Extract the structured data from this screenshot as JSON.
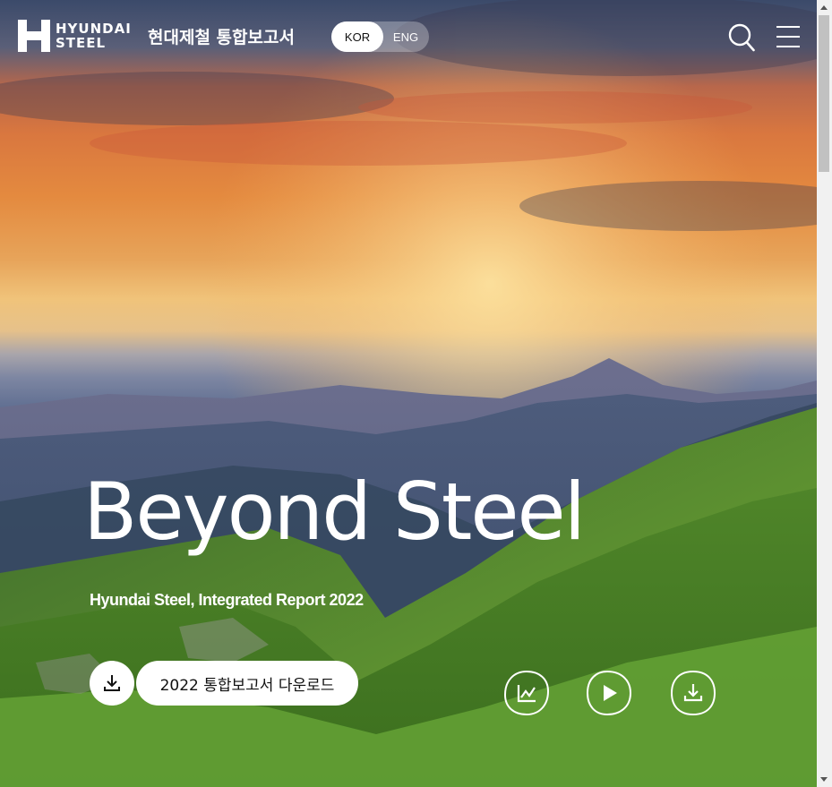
{
  "header": {
    "logo_line1": "HYUNDAI",
    "logo_line2": "STEEL",
    "site_title": "현대제철 통합보고서",
    "languages": [
      {
        "label": "KOR",
        "active": true
      },
      {
        "label": "ENG",
        "active": false
      }
    ],
    "icons": [
      "search-icon",
      "menu-icon"
    ]
  },
  "hero": {
    "title": "Beyond Steel",
    "subtitle": "Hyundai Steel,  Integrated Report 2022",
    "download_label": "2022 통합보고서 다운로드"
  },
  "quick_links": [
    {
      "icon": "chart-icon"
    },
    {
      "icon": "play-icon"
    },
    {
      "icon": "download-icon"
    }
  ],
  "colors": {
    "text_on_image": "#ffffff",
    "button_bg": "#ffffff",
    "button_text": "#111111"
  }
}
